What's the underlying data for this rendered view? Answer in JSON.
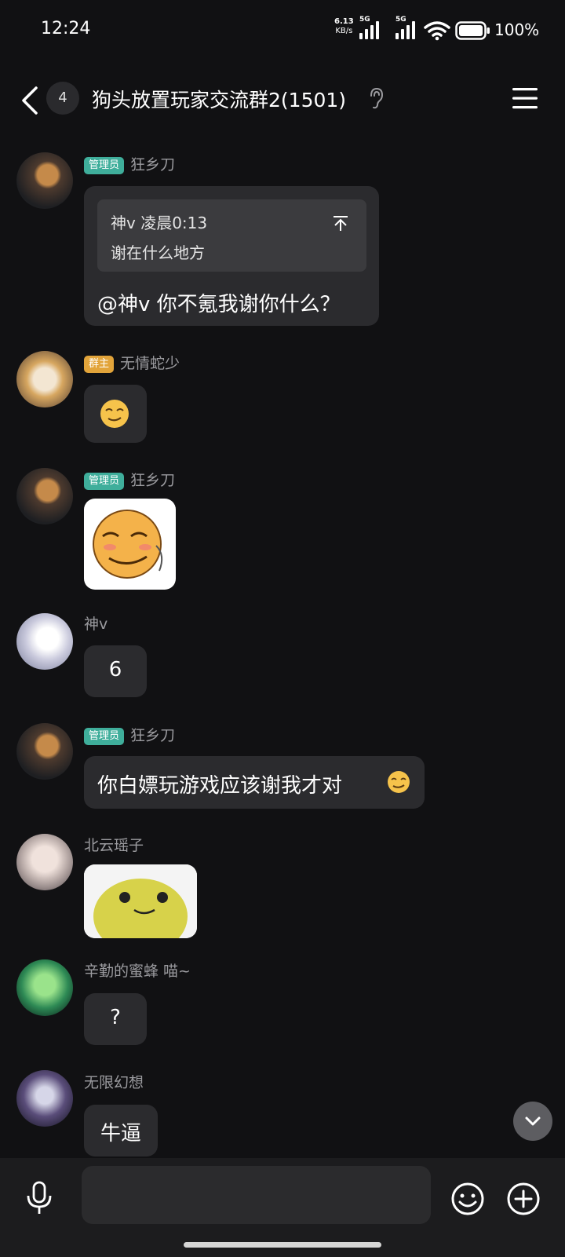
{
  "status_bar": {
    "time": "12:24",
    "net_speed_value": "6.13",
    "net_speed_unit": "KB/s",
    "signal1_label": "5G",
    "signal2_label": "5G",
    "battery": "100%"
  },
  "header": {
    "unread_count": "4",
    "title": "狗头放置玩家交流群2(1501)"
  },
  "messages": [
    {
      "badge": "管理员",
      "sender": "狂乡刀",
      "quote_header": "神v 凌晨0:13",
      "quote_text": "谢在什么地方",
      "text": "@神v 你不氪我谢你什么？"
    },
    {
      "badge": "群主",
      "sender": "无情蛇少"
    },
    {
      "badge": "管理员",
      "sender": "狂乡刀"
    },
    {
      "sender": "神v",
      "text": "6"
    },
    {
      "badge": "管理员",
      "sender": "狂乡刀",
      "text": "你白嫖玩游戏应该谢我才对"
    },
    {
      "sender": "北云瑶子"
    },
    {
      "sender": "辛勤的蜜蜂 喵~",
      "text": "?"
    },
    {
      "sender": "无限幻想",
      "text": "牛逼"
    }
  ],
  "colors": {
    "background": "#111113",
    "bubble": "#2b2b2e",
    "admin_badge": "#3fae9b",
    "owner_badge": "#e2a43a"
  }
}
